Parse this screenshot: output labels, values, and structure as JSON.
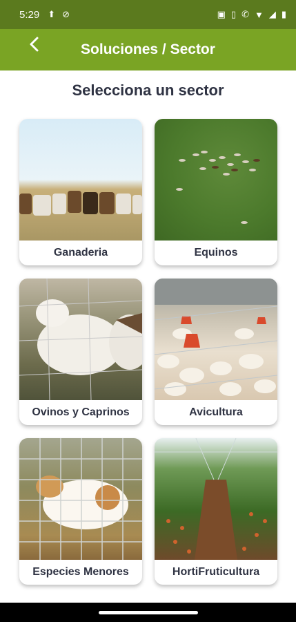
{
  "status_bar": {
    "time": "5:29",
    "icons": [
      "upload-icon",
      "blocked-icon",
      "cast-icon",
      "vibrate-icon",
      "call-wifi-icon",
      "wifi-icon",
      "signal-icon",
      "battery-icon"
    ]
  },
  "app_bar": {
    "title": "Soluciones / Sector",
    "back_icon": "chevron-left-icon",
    "color": "#7aa424"
  },
  "heading": "Selecciona un sector",
  "sectors": [
    {
      "label": "Ganaderia",
      "image": "cattle-herd"
    },
    {
      "label": "Equinos",
      "image": "horses-field"
    },
    {
      "label": "Ovinos y Caprinos",
      "image": "sheep-goat"
    },
    {
      "label": "Avicultura",
      "image": "poultry-farm"
    },
    {
      "label": "Especies Menores",
      "image": "guinea-pig"
    },
    {
      "label": "HortiFruticultura",
      "image": "greenhouse"
    }
  ]
}
